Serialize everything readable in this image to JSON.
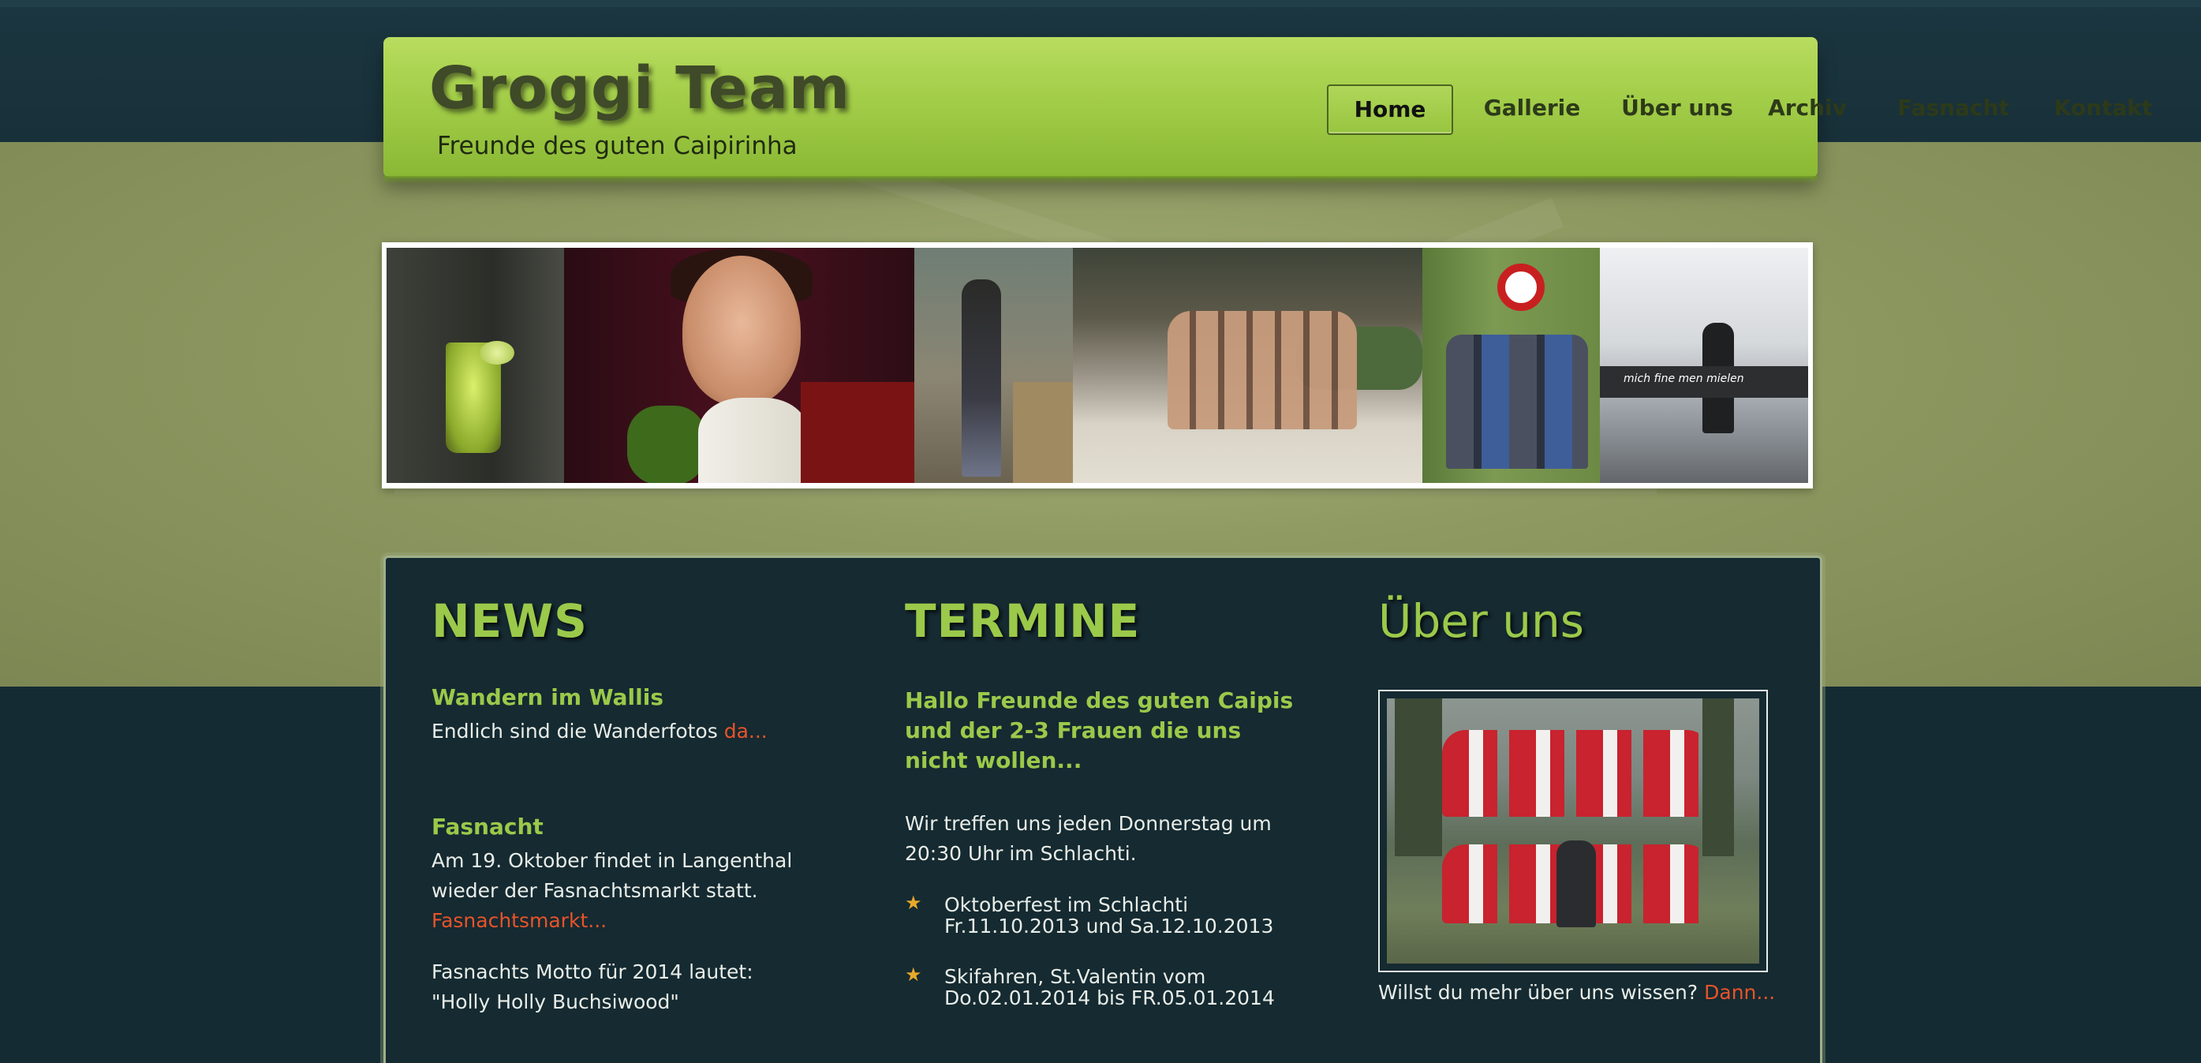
{
  "site": {
    "title": "Groggi Team",
    "tagline": "Freunde des guten Caipirinha"
  },
  "nav": {
    "items": [
      {
        "label": "Home",
        "active": true
      },
      {
        "label": "Gallerie",
        "active": false
      },
      {
        "label": "Über uns",
        "active": false
      },
      {
        "label": "Archiv",
        "active": false
      },
      {
        "label": "Fasnacht",
        "active": false
      },
      {
        "label": "Kontakt",
        "active": false
      }
    ]
  },
  "news": {
    "heading": "NEWS",
    "items": [
      {
        "title": "Wandern im Wallis",
        "text": "Endlich sind die Wanderfotos ",
        "link": "da..."
      },
      {
        "title": "Fasnacht",
        "text": "Am 19. Oktober findet in Langenthal wieder der Fasnachtsmarkt statt.",
        "link": "Fasnachtsmarkt..."
      },
      {
        "text": "Fasnachts Motto für 2014 lautet: \"Holly Holly Buchsiwood\""
      }
    ]
  },
  "termine": {
    "heading": "TERMINE",
    "intro": "Hallo Freunde des guten Caipis und der 2-3 Frauen die uns nicht wollen...",
    "text": "Wir treffen uns jeden Donnerstag um 20:30 Uhr im Schlachti.",
    "events": [
      {
        "line1": "Oktoberfest im Schlachti",
        "line2": "Fr.11.10.2013 und Sa.12.10.2013"
      },
      {
        "line1": "Skifahren, St.Valentin vom",
        "line2": "Do.02.01.2014 bis FR.05.01.2014"
      }
    ]
  },
  "ueber": {
    "heading": "Über uns",
    "text": "Willst du mehr über uns wissen? ",
    "link": "Dann..."
  },
  "banner": {
    "railing_text": "mich fine men mielen"
  },
  "colors": {
    "accent_green": "#9bc94a",
    "link_orange": "#e8532a",
    "panel_bg": "#152a31",
    "header_green": "#a2cd48"
  }
}
